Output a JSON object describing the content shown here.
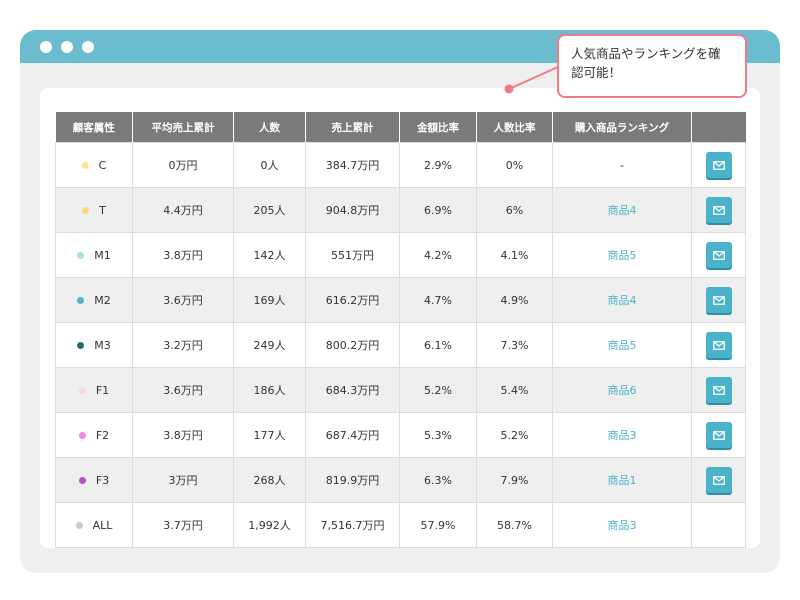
{
  "callout": {
    "text": "人気商品やランキングを確認可能！"
  },
  "table": {
    "headers": [
      "顧客属性",
      "平均売上累計",
      "人数",
      "売上累計",
      "金額比率",
      "人数比率",
      "購入商品ランキング",
      ""
    ],
    "rows": [
      {
        "attr": "C",
        "dot_color": "#fde49a",
        "avg": "0万円",
        "people": "0人",
        "sales": "384.7万円",
        "amount_ratio": "2.9%",
        "people_ratio": "0%",
        "ranking": "-",
        "mail": true
      },
      {
        "attr": "T",
        "dot_color": "#f9d77a",
        "avg": "4.4万円",
        "people": "205人",
        "sales": "904.8万円",
        "amount_ratio": "6.9%",
        "people_ratio": "6%",
        "ranking": "商品4",
        "mail": true
      },
      {
        "attr": "M1",
        "dot_color": "#a8e0e2",
        "avg": "3.8万円",
        "people": "142人",
        "sales": "551万円",
        "amount_ratio": "4.2%",
        "people_ratio": "4.1%",
        "ranking": "商品5",
        "mail": true
      },
      {
        "attr": "M2",
        "dot_color": "#4fb8bd",
        "avg": "3.6万円",
        "people": "169人",
        "sales": "616.2万円",
        "amount_ratio": "4.7%",
        "people_ratio": "4.9%",
        "ranking": "商品4",
        "mail": true
      },
      {
        "attr": "M3",
        "dot_color": "#1a6f73",
        "avg": "3.2万円",
        "people": "249人",
        "sales": "800.2万円",
        "amount_ratio": "6.1%",
        "people_ratio": "7.3%",
        "ranking": "商品5",
        "mail": true
      },
      {
        "attr": "F1",
        "dot_color": "#fbd3ea",
        "avg": "3.6万円",
        "people": "186人",
        "sales": "684.3万円",
        "amount_ratio": "5.2%",
        "people_ratio": "5.4%",
        "ranking": "商品6",
        "mail": true
      },
      {
        "attr": "F2",
        "dot_color": "#ee88dc",
        "avg": "3.8万円",
        "people": "177人",
        "sales": "687.4万円",
        "amount_ratio": "5.3%",
        "people_ratio": "5.2%",
        "ranking": "商品3",
        "mail": true
      },
      {
        "attr": "F3",
        "dot_color": "#b651c6",
        "avg": "3万円",
        "people": "268人",
        "sales": "819.9万円",
        "amount_ratio": "6.3%",
        "people_ratio": "7.9%",
        "ranking": "商品1",
        "mail": true
      },
      {
        "attr": "ALL",
        "dot_color": "#cccccc",
        "avg": "3.7万円",
        "people": "1,992人",
        "sales": "7,516.7万円",
        "amount_ratio": "57.9%",
        "people_ratio": "58.7%",
        "ranking": "商品3",
        "mail": false
      }
    ]
  },
  "colors": {
    "titlebar": "#6bbccf",
    "accent": "#4ab3c9",
    "callout_border": "#f07b86"
  },
  "icons": {
    "mail": "mail-icon"
  }
}
